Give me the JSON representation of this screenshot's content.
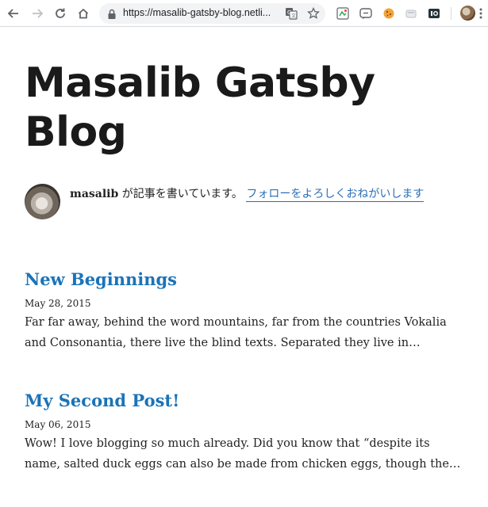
{
  "browser": {
    "url": "https://masalib-gatsby-blog.netli...",
    "icons": {
      "back": "arrow-left-icon",
      "forward": "arrow-right-icon",
      "reload": "reload-icon",
      "home": "home-icon",
      "lock": "lock-icon",
      "translate": "translate-icon",
      "bookmark": "star-icon",
      "menu": "kebab-menu-icon"
    },
    "extensions": [
      "extension-icon-1",
      "extension-icon-2",
      "cookie-icon",
      "extension-icon-4",
      "extension-icon-5"
    ]
  },
  "site": {
    "title": "Masalib Gatsby Blog"
  },
  "bio": {
    "author": "masalib",
    "text": " が記事を書いています。 ",
    "follow_link": "フォローをよろしくおねがいします"
  },
  "posts": [
    {
      "title": "New Beginnings",
      "date": "May 28, 2015",
      "excerpt": "Far far away, behind the word mountains, far from the countries Vokalia and Consonantia, there live the blind texts. Separated they live in…"
    },
    {
      "title": "My Second Post!",
      "date": "May 06, 2015",
      "excerpt": "Wow! I love blogging so much already. Did you know that “despite its name, salted duck eggs can also be made from chicken eggs, though the…"
    }
  ],
  "colors": {
    "link": "#1a73b8",
    "title": "#1a1a1a"
  }
}
